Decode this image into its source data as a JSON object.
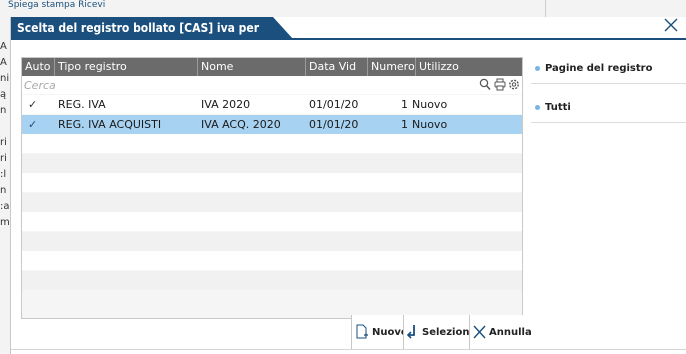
{
  "background": {
    "top_text": "Spiega stampa Ricevi",
    "left_fragments": [
      "A",
      "A",
      "ni",
      "ą",
      "n",
      "",
      "ri",
      "ri",
      ":l",
      "n",
      ":a",
      "m"
    ]
  },
  "dialog": {
    "title": "Scelta del registro bollato [CAS] iva per cassa",
    "close_icon": "close-icon"
  },
  "grid": {
    "columns": [
      {
        "key": "auto",
        "label": "Auto"
      },
      {
        "key": "tipo",
        "label": "Tipo registro"
      },
      {
        "key": "nome",
        "label": "Nome"
      },
      {
        "key": "data_vid",
        "label": "Data Vid"
      },
      {
        "key": "numero",
        "label": "Numero"
      },
      {
        "key": "utilizzo",
        "label": "Utilizzo"
      }
    ],
    "search_placeholder": "Cerca",
    "toolbar_icons": [
      "search-icon",
      "print-icon",
      "gear-icon"
    ],
    "rows": [
      {
        "auto": "✓",
        "tipo": "REG. IVA",
        "nome": "IVA 2020",
        "data_vid": "01/01/20",
        "numero": "1",
        "utilizzo": "Nuovo",
        "selected": false
      },
      {
        "auto": "✓",
        "tipo": "REG. IVA ACQUISTI",
        "nome": "IVA ACQ. 2020",
        "data_vid": "01/01/20",
        "numero": "1",
        "utilizzo": "Nuovo",
        "selected": true
      }
    ],
    "empty_rows": 8,
    "selected_color": "#a8d2f1",
    "header_color": "#6b6b6b"
  },
  "side_panel": {
    "items": [
      {
        "label": "Pagine del registro"
      },
      {
        "label": "Tutti"
      }
    ]
  },
  "buttons": {
    "nuovo": "Nuovo",
    "seleziona": "Seleziona",
    "annulla": "Annulla"
  },
  "colors": {
    "title_bar": "#1b4f7e",
    "accent_dot": "#7ab4e0"
  }
}
